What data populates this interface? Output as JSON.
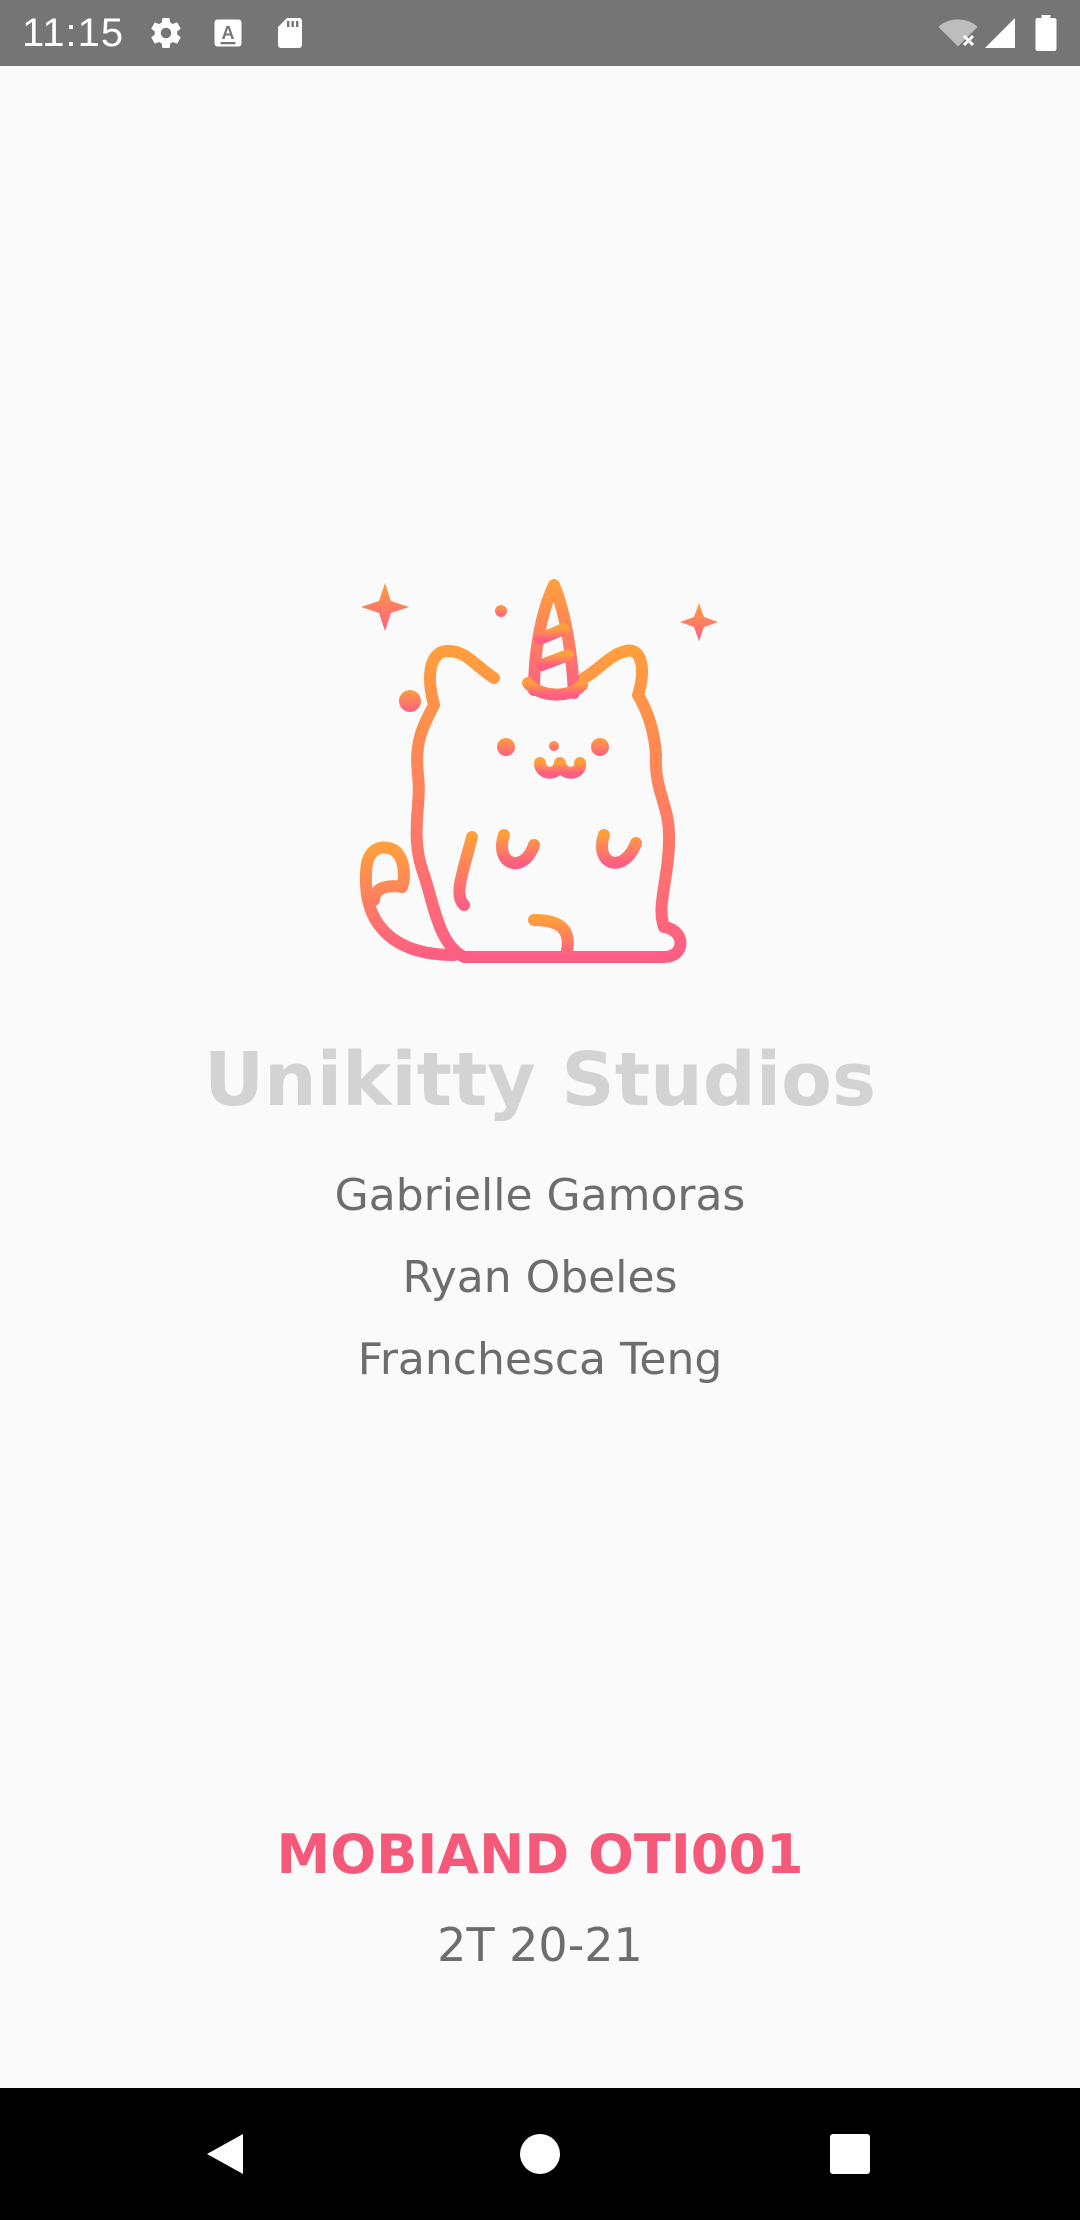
{
  "status_bar": {
    "time": "11:15",
    "left_icons": [
      "gear-icon",
      "font-a-icon",
      "sd-card-icon"
    ],
    "right_icons": [
      "wifi-off-icon",
      "signal-icon",
      "battery-icon"
    ]
  },
  "app": {
    "logo_icon": "unicorn-cat-icon",
    "studio_name": "Unikitty Studios",
    "members": [
      "Gabrielle Gamoras",
      "Ryan Obeles",
      "Franchesca Teng"
    ],
    "course_code": "MOBIAND OTI001",
    "term": "2T 20-21"
  },
  "nav_bar": {
    "buttons": [
      "back-icon",
      "home-icon",
      "recents-icon"
    ]
  },
  "colors": {
    "status_bar": "#757575",
    "background": "#fafafa",
    "title": "#d3d3d3",
    "member_text": "#6d6d6d",
    "accent_pink": "#f5597a",
    "logo_orange": "#ff9e3d",
    "logo_pink": "#fd5f84"
  }
}
